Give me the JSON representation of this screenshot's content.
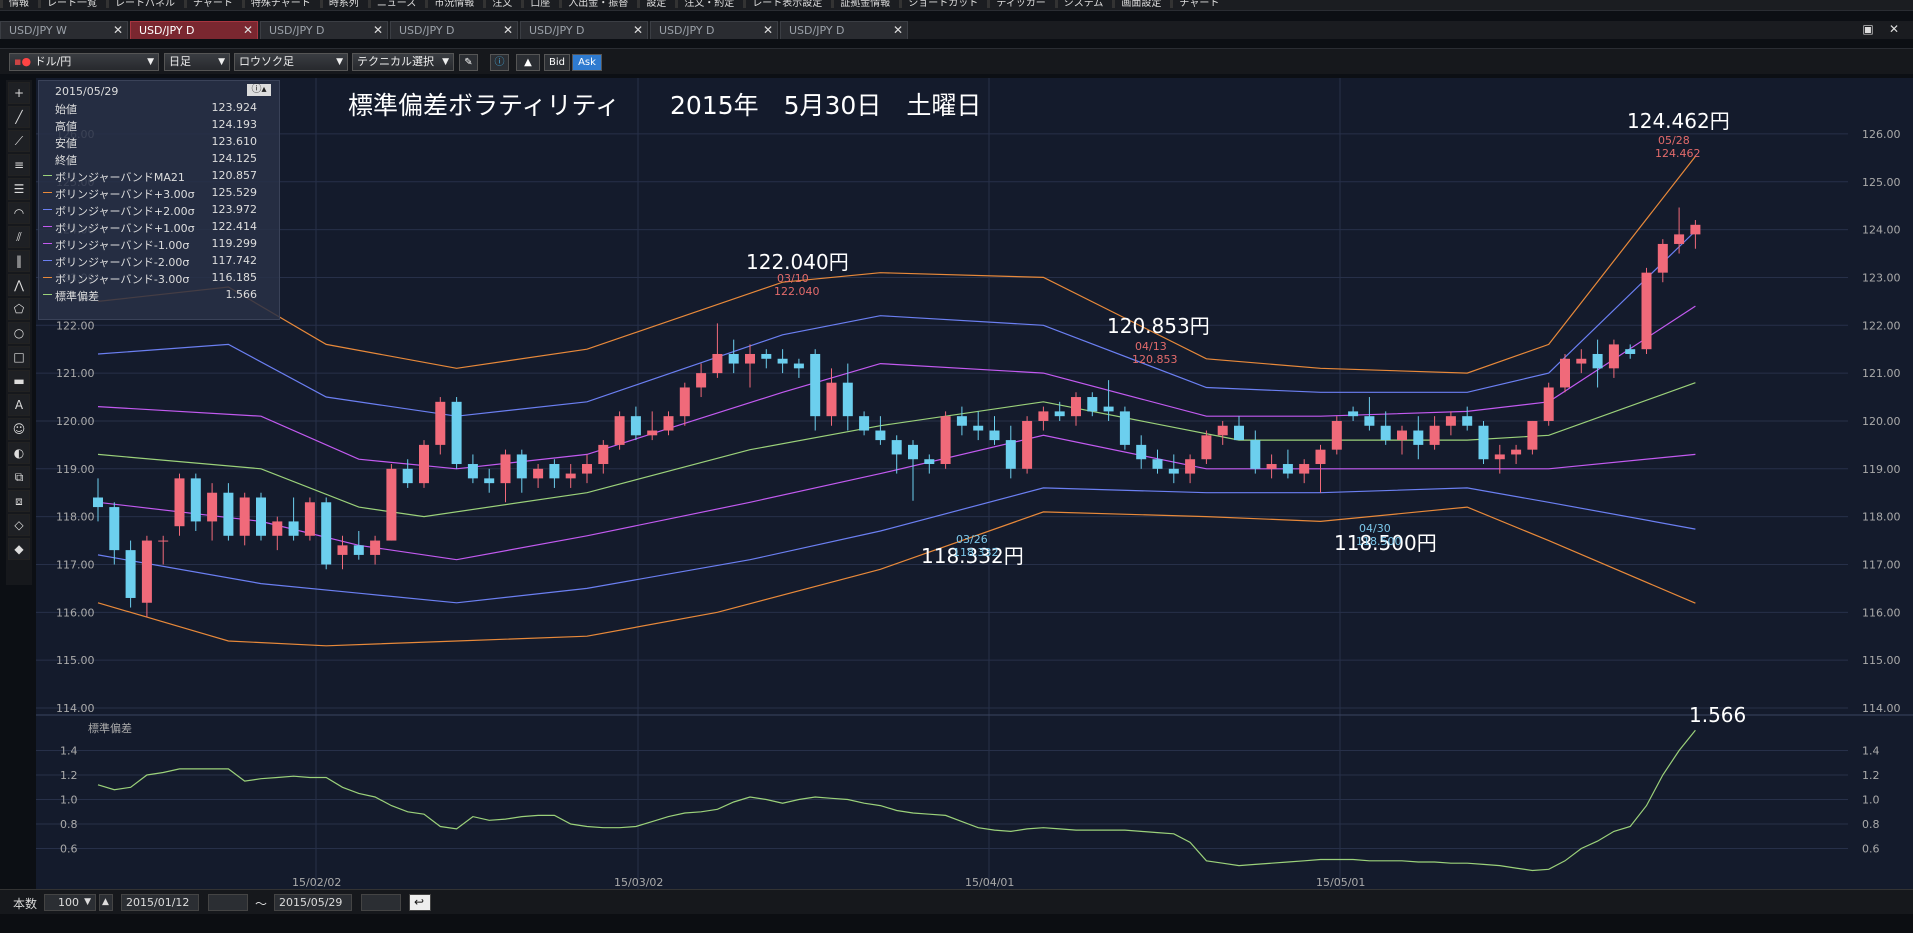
{
  "menu": {
    "items": [
      "情報",
      "レート一覧",
      "レートパネル",
      "チャート",
      "特殊チャート",
      "時系列",
      "ニュース",
      "市況情報",
      "注文",
      "口座",
      "入出金・振替",
      "設定",
      "注文・約定",
      "レート表示設定",
      "証拠金情報",
      "ショートカット",
      "ティッカー",
      "システム",
      "画面設定",
      "チャート"
    ]
  },
  "tabs": [
    {
      "label": "USD/JPY W"
    },
    {
      "label": "USD/JPY D"
    },
    {
      "label": "USD/JPY D"
    },
    {
      "label": "USD/JPY D"
    },
    {
      "label": "USD/JPY D"
    },
    {
      "label": "USD/JPY D"
    },
    {
      "label": "USD/JPY D"
    }
  ],
  "toolbar": {
    "pair": "ドル/円",
    "period": "日足",
    "chart_type": "ロウソク足",
    "technical": "テクニカル選択",
    "bid": "Bid",
    "ask": "Ask"
  },
  "info": {
    "date": "2015/05/29",
    "rows": [
      {
        "label": "始値",
        "value": "123.924"
      },
      {
        "label": "高値",
        "value": "124.193"
      },
      {
        "label": "安値",
        "value": "123.610"
      },
      {
        "label": "終値",
        "value": "124.125"
      },
      {
        "label": "ボリンジャーバンドMA21",
        "value": "120.857",
        "color": "#9bd17a"
      },
      {
        "label": "ボリンジャーバンド+3.00σ",
        "value": "125.529",
        "color": "#e8893a"
      },
      {
        "label": "ボリンジャーバンド+2.00σ",
        "value": "123.972",
        "color": "#6b7ff2"
      },
      {
        "label": "ボリンジャーバンド+1.00σ",
        "value": "122.414",
        "color": "#c25af0"
      },
      {
        "label": "ボリンジャーバンド-1.00σ",
        "value": "119.299",
        "color": "#c25af0"
      },
      {
        "label": "ボリンジャーバンド-2.00σ",
        "value": "117.742",
        "color": "#6b7ff2"
      },
      {
        "label": "ボリンジャーバンド-3.00σ",
        "value": "116.185",
        "color": "#e8893a"
      },
      {
        "label": "標準偏差",
        "value": "1.566",
        "color": "#9bd17a"
      }
    ]
  },
  "chart_data": {
    "type": "candlestick",
    "title": "標準偏差ボラティリティ　　2015年　5月30日　土曜日",
    "yticks": [
      "126.00",
      "125.00",
      "124.00",
      "123.00",
      "122.00",
      "121.00",
      "120.00",
      "119.00",
      "118.00",
      "117.00",
      "116.00",
      "115.00",
      "114.00"
    ],
    "ylim": [
      114,
      126.5
    ],
    "xticks": [
      "15/02/02",
      "15/03/02",
      "15/04/01",
      "15/05/01"
    ],
    "annotations": [
      {
        "label": "122.040円",
        "date": "03/10",
        "value": "122.040",
        "type": "high"
      },
      {
        "label": "120.853円",
        "date": "04/13",
        "value": "120.853",
        "type": "high"
      },
      {
        "label": "118.332円",
        "date": "03/26",
        "value": "118.332",
        "type": "low"
      },
      {
        "label": "118.500円",
        "date": "04/30",
        "value": "118.500",
        "type": "low"
      },
      {
        "label": "124.462円",
        "date": "05/28",
        "value": "124.462",
        "type": "high"
      }
    ],
    "candles": [
      [
        118.4,
        118.8,
        117.9,
        118.2
      ],
      [
        118.2,
        118.3,
        117.0,
        117.3
      ],
      [
        117.3,
        117.5,
        116.1,
        116.3
      ],
      [
        116.2,
        117.6,
        115.9,
        117.5
      ],
      [
        117.5,
        117.6,
        117.0,
        117.5
      ],
      [
        117.8,
        118.9,
        117.6,
        118.8
      ],
      [
        118.8,
        118.9,
        117.7,
        117.9
      ],
      [
        117.9,
        118.7,
        117.5,
        118.5
      ],
      [
        118.5,
        118.7,
        117.5,
        117.6
      ],
      [
        117.6,
        118.5,
        117.4,
        118.4
      ],
      [
        118.4,
        118.5,
        117.5,
        117.6
      ],
      [
        117.6,
        118.0,
        117.3,
        117.9
      ],
      [
        117.9,
        118.4,
        117.5,
        117.6
      ],
      [
        117.6,
        118.4,
        117.5,
        118.3
      ],
      [
        118.3,
        118.4,
        116.9,
        117.0
      ],
      [
        117.2,
        117.6,
        116.9,
        117.4
      ],
      [
        117.4,
        117.7,
        117.1,
        117.2
      ],
      [
        117.2,
        117.6,
        117.0,
        117.5
      ],
      [
        117.5,
        119.1,
        117.5,
        119.0
      ],
      [
        119.0,
        119.2,
        118.6,
        118.7
      ],
      [
        118.7,
        119.6,
        118.6,
        119.5
      ],
      [
        119.5,
        120.5,
        119.3,
        120.4
      ],
      [
        120.4,
        120.5,
        119.0,
        119.1
      ],
      [
        119.1,
        119.3,
        118.7,
        118.8
      ],
      [
        118.8,
        119.0,
        118.5,
        118.7
      ],
      [
        118.7,
        119.4,
        118.3,
        119.3
      ],
      [
        119.3,
        119.4,
        118.5,
        118.8
      ],
      [
        118.8,
        119.1,
        118.6,
        119.0
      ],
      [
        119.1,
        119.2,
        118.6,
        118.8
      ],
      [
        118.8,
        119.1,
        118.6,
        118.9
      ],
      [
        118.9,
        119.3,
        118.7,
        119.1
      ],
      [
        119.1,
        119.6,
        118.9,
        119.5
      ],
      [
        119.5,
        120.2,
        119.4,
        120.1
      ],
      [
        120.1,
        120.3,
        119.6,
        119.7
      ],
      [
        119.7,
        120.2,
        119.6,
        119.8
      ],
      [
        119.8,
        120.2,
        119.7,
        120.1
      ],
      [
        120.1,
        120.8,
        119.9,
        120.7
      ],
      [
        120.7,
        121.2,
        120.5,
        121.0
      ],
      [
        121.0,
        122.04,
        120.9,
        121.4
      ],
      [
        121.4,
        121.7,
        121.0,
        121.2
      ],
      [
        121.2,
        121.6,
        120.7,
        121.4
      ],
      [
        121.4,
        121.5,
        121.1,
        121.3
      ],
      [
        121.3,
        121.5,
        121.0,
        121.2
      ],
      [
        121.2,
        121.3,
        120.9,
        121.1
      ],
      [
        121.4,
        121.5,
        119.8,
        120.1
      ],
      [
        120.1,
        121.1,
        119.9,
        120.8
      ],
      [
        120.8,
        121.2,
        119.8,
        120.1
      ],
      [
        120.1,
        120.2,
        119.7,
        119.8
      ],
      [
        119.8,
        120.1,
        119.5,
        119.6
      ],
      [
        119.6,
        119.7,
        118.9,
        119.3
      ],
      [
        119.5,
        119.6,
        118.332,
        119.2
      ],
      [
        119.2,
        119.3,
        118.9,
        119.1
      ],
      [
        119.1,
        120.2,
        119.0,
        120.1
      ],
      [
        120.1,
        120.3,
        119.7,
        119.9
      ],
      [
        119.9,
        120.2,
        119.6,
        119.8
      ],
      [
        119.8,
        120.1,
        119.5,
        119.6
      ],
      [
        119.6,
        119.9,
        118.8,
        119.0
      ],
      [
        119.0,
        120.1,
        118.9,
        120.0
      ],
      [
        120.0,
        120.3,
        119.8,
        120.2
      ],
      [
        120.2,
        120.4,
        120.0,
        120.1
      ],
      [
        120.1,
        120.6,
        119.9,
        120.5
      ],
      [
        120.5,
        120.6,
        120.1,
        120.2
      ],
      [
        120.3,
        120.853,
        120.0,
        120.2
      ],
      [
        120.2,
        120.3,
        119.4,
        119.5
      ],
      [
        119.5,
        119.7,
        119.0,
        119.2
      ],
      [
        119.2,
        119.4,
        118.9,
        119.0
      ],
      [
        119.0,
        119.3,
        118.7,
        118.9
      ],
      [
        118.9,
        119.3,
        118.7,
        119.2
      ],
      [
        119.2,
        119.8,
        119.1,
        119.7
      ],
      [
        119.7,
        120.0,
        119.5,
        119.9
      ],
      [
        119.9,
        120.1,
        119.6,
        119.6
      ],
      [
        119.6,
        119.8,
        118.9,
        119.0
      ],
      [
        119.0,
        119.3,
        118.8,
        119.1
      ],
      [
        119.1,
        119.4,
        118.8,
        118.9
      ],
      [
        118.9,
        119.2,
        118.7,
        119.1
      ],
      [
        119.1,
        119.5,
        118.5,
        119.4
      ],
      [
        119.4,
        120.1,
        119.3,
        120.0
      ],
      [
        120.2,
        120.3,
        120.0,
        120.1
      ],
      [
        120.1,
        120.5,
        119.8,
        119.9
      ],
      [
        119.9,
        120.2,
        119.5,
        119.6
      ],
      [
        119.6,
        119.9,
        119.3,
        119.8
      ],
      [
        119.8,
        120.1,
        119.2,
        119.5
      ],
      [
        119.5,
        120.1,
        119.4,
        119.9
      ],
      [
        119.9,
        120.2,
        119.7,
        120.1
      ],
      [
        120.1,
        120.3,
        119.8,
        119.9
      ],
      [
        119.9,
        120.0,
        119.1,
        119.2
      ],
      [
        119.2,
        119.5,
        118.9,
        119.3
      ],
      [
        119.3,
        119.5,
        119.1,
        119.4
      ],
      [
        119.4,
        120.0,
        119.3,
        120.0
      ],
      [
        120.0,
        120.8,
        119.9,
        120.7
      ],
      [
        120.7,
        121.4,
        120.6,
        121.3
      ],
      [
        121.2,
        121.5,
        121.0,
        121.3
      ],
      [
        121.4,
        121.7,
        120.7,
        121.1
      ],
      [
        121.1,
        121.7,
        120.9,
        121.6
      ],
      [
        121.5,
        121.6,
        121.3,
        121.4
      ],
      [
        121.5,
        123.2,
        121.4,
        123.1
      ],
      [
        123.1,
        123.8,
        122.9,
        123.7
      ],
      [
        123.7,
        124.462,
        123.5,
        123.9
      ],
      [
        123.9,
        124.2,
        123.6,
        124.1
      ]
    ],
    "bands": {
      "ma21": {
        "color": "#9bd17a",
        "points": [
          [
            0,
            119.3
          ],
          [
            10,
            119.0
          ],
          [
            16,
            118.2
          ],
          [
            20,
            118.0
          ],
          [
            30,
            118.5
          ],
          [
            40,
            119.4
          ],
          [
            48,
            119.9
          ],
          [
            58,
            120.4
          ],
          [
            70,
            119.6
          ],
          [
            75,
            119.6
          ],
          [
            84,
            119.6
          ],
          [
            89,
            119.7
          ],
          [
            98,
            120.8
          ]
        ]
      },
      "p1": {
        "color": "#c25af0",
        "points": [
          [
            0,
            120.3
          ],
          [
            10,
            120.1
          ],
          [
            16,
            119.2
          ],
          [
            22,
            119.0
          ],
          [
            30,
            119.3
          ],
          [
            42,
            120.6
          ],
          [
            48,
            121.2
          ],
          [
            58,
            121.0
          ],
          [
            68,
            120.1
          ],
          [
            75,
            120.1
          ],
          [
            84,
            120.2
          ],
          [
            89,
            120.4
          ],
          [
            98,
            122.4
          ]
        ]
      },
      "p2": {
        "color": "#6b7ff2",
        "points": [
          [
            0,
            121.4
          ],
          [
            8,
            121.6
          ],
          [
            14,
            120.5
          ],
          [
            22,
            120.1
          ],
          [
            30,
            120.4
          ],
          [
            42,
            121.8
          ],
          [
            48,
            122.2
          ],
          [
            58,
            122.0
          ],
          [
            68,
            120.7
          ],
          [
            75,
            120.6
          ],
          [
            84,
            120.6
          ],
          [
            89,
            121.0
          ],
          [
            98,
            123.97
          ]
        ]
      },
      "p3": {
        "color": "#e8893a",
        "points": [
          [
            0,
            122.5
          ],
          [
            8,
            122.8
          ],
          [
            14,
            121.6
          ],
          [
            22,
            121.1
          ],
          [
            30,
            121.5
          ],
          [
            42,
            122.9
          ],
          [
            48,
            123.1
          ],
          [
            58,
            123.0
          ],
          [
            68,
            121.3
          ],
          [
            75,
            121.1
          ],
          [
            84,
            121.0
          ],
          [
            89,
            121.6
          ],
          [
            98,
            125.53
          ]
        ]
      },
      "m1": {
        "color": "#c25af0",
        "points": [
          [
            0,
            118.3
          ],
          [
            10,
            117.9
          ],
          [
            16,
            117.4
          ],
          [
            22,
            117.1
          ],
          [
            30,
            117.6
          ],
          [
            40,
            118.3
          ],
          [
            48,
            118.9
          ],
          [
            58,
            119.7
          ],
          [
            68,
            119.0
          ],
          [
            75,
            119.0
          ],
          [
            84,
            119.0
          ],
          [
            89,
            119.0
          ],
          [
            98,
            119.3
          ]
        ]
      },
      "m2": {
        "color": "#6b7ff2",
        "points": [
          [
            0,
            117.2
          ],
          [
            10,
            116.6
          ],
          [
            16,
            116.4
          ],
          [
            22,
            116.2
          ],
          [
            30,
            116.5
          ],
          [
            40,
            117.1
          ],
          [
            48,
            117.7
          ],
          [
            58,
            118.6
          ],
          [
            68,
            118.5
          ],
          [
            75,
            118.5
          ],
          [
            84,
            118.6
          ],
          [
            89,
            118.3
          ],
          [
            98,
            117.74
          ]
        ]
      },
      "m3": {
        "color": "#e8893a",
        "points": [
          [
            0,
            116.2
          ],
          [
            8,
            115.4
          ],
          [
            14,
            115.3
          ],
          [
            22,
            115.4
          ],
          [
            30,
            115.5
          ],
          [
            38,
            116.0
          ],
          [
            48,
            116.9
          ],
          [
            58,
            118.1
          ],
          [
            68,
            118.0
          ],
          [
            75,
            117.9
          ],
          [
            84,
            118.2
          ],
          [
            89,
            117.5
          ],
          [
            98,
            116.19
          ]
        ]
      }
    },
    "sub": {
      "label": "標準偏差",
      "yticks": [
        "1.4",
        "1.2",
        "1.0",
        "0.8",
        "0.6"
      ],
      "last_value": "1.566",
      "values": [
        1.12,
        1.08,
        1.1,
        1.2,
        1.22,
        1.25,
        1.25,
        1.25,
        1.25,
        1.15,
        1.17,
        1.18,
        1.19,
        1.18,
        1.18,
        1.1,
        1.05,
        1.02,
        0.95,
        0.9,
        0.88,
        0.78,
        0.76,
        0.86,
        0.83,
        0.84,
        0.86,
        0.87,
        0.87,
        0.8,
        0.78,
        0.77,
        0.77,
        0.78,
        0.82,
        0.86,
        0.89,
        0.9,
        0.92,
        0.98,
        1.02,
        1.0,
        0.97,
        1.0,
        1.02,
        1.01,
        1.0,
        0.97,
        0.95,
        0.91,
        0.89,
        0.88,
        0.87,
        0.82,
        0.77,
        0.75,
        0.74,
        0.76,
        0.77,
        0.76,
        0.75,
        0.75,
        0.75,
        0.75,
        0.74,
        0.73,
        0.72,
        0.65,
        0.5,
        0.48,
        0.46,
        0.47,
        0.48,
        0.49,
        0.5,
        0.51,
        0.51,
        0.51,
        0.5,
        0.5,
        0.5,
        0.49,
        0.49,
        0.48,
        0.48,
        0.47,
        0.46,
        0.44,
        0.42,
        0.43,
        0.5,
        0.6,
        0.66,
        0.74,
        0.78,
        0.95,
        1.2,
        1.4,
        1.566
      ]
    }
  },
  "bottom": {
    "count_label": "本数",
    "count": "100",
    "date_from": "2015/01/12",
    "tilde": "～",
    "date_to": "2015/05/29"
  }
}
